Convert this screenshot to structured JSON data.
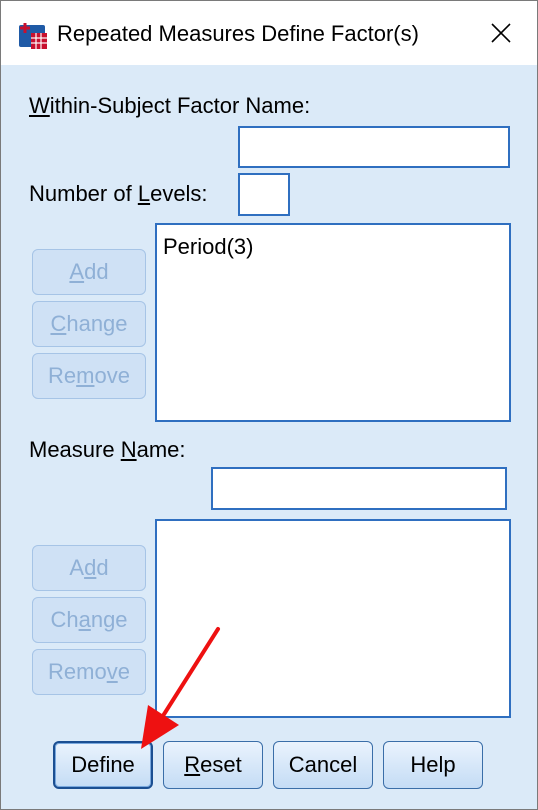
{
  "window": {
    "title": "Repeated Measures Define Factor(s)",
    "icon": "spss-table-icon",
    "close_glyph": "×"
  },
  "factor": {
    "name_label_pre": "",
    "name_label_ul": "W",
    "name_label_post": "ithin-Subject Factor Name:",
    "name_value": "",
    "levels_label_pre": "Number of ",
    "levels_label_ul": "L",
    "levels_label_post": "evels:",
    "levels_value": "",
    "list": [
      "Period(3)"
    ],
    "buttons": {
      "add": {
        "pre": "",
        "ul": "A",
        "post": "dd"
      },
      "change": {
        "pre": "",
        "ul": "C",
        "post": "hange"
      },
      "remove": {
        "pre": "Re",
        "ul": "m",
        "post": "ove"
      }
    }
  },
  "measure": {
    "name_label_pre": "Measure ",
    "name_label_ul": "N",
    "name_label_post": "ame:",
    "name_value": "",
    "list": [],
    "buttons": {
      "add": {
        "pre": "A",
        "ul": "d",
        "post": "d"
      },
      "change": {
        "pre": "Ch",
        "ul": "a",
        "post": "nge"
      },
      "remove": {
        "pre": "Remo",
        "ul": "v",
        "post": "e"
      }
    }
  },
  "footer": {
    "define": {
      "pre": "Define",
      "ul": "",
      "post": ""
    },
    "reset": {
      "pre": "",
      "ul": "R",
      "post": "eset"
    },
    "cancel": {
      "pre": "Cancel",
      "ul": "",
      "post": ""
    },
    "help": {
      "pre": "Help",
      "ul": "",
      "post": ""
    }
  },
  "colors": {
    "dialog_bg": "#dbeaf8",
    "field_border": "#2f6fc0",
    "disabled_text": "#8fb0d6",
    "annotation_arrow": "#ee1111"
  }
}
